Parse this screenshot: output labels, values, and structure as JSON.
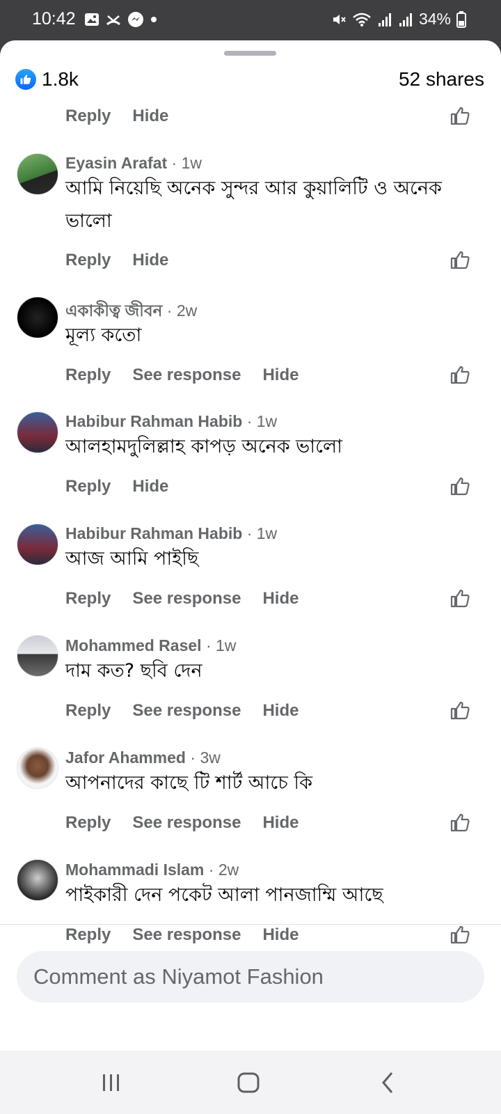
{
  "status_bar": {
    "time": "10:42",
    "battery": "34%",
    "left_icons": [
      "gallery-icon",
      "missed-call-icon",
      "messenger-icon",
      "dot-icon"
    ],
    "right_icons": [
      "mute-icon",
      "wifi-icon",
      "signal-icon",
      "signal-icon",
      "battery-icon"
    ]
  },
  "post_stats": {
    "reaction_count": "1.8k",
    "shares": "52 shares"
  },
  "top_actions": {
    "reply": "Reply",
    "hide": "Hide"
  },
  "comments": [
    {
      "name": "Eyasin Arafat",
      "time": "1w",
      "text": "আমি নিয়েছি অনেক সুন্দর আর কুয়ালিটি ও অনেক ভালো",
      "actions": [
        "Reply",
        "Hide"
      ]
    },
    {
      "name": "একাকীত্ব জীবন",
      "time": "2w",
      "text": "মূল্য কতো",
      "actions": [
        "Reply",
        "See response",
        "Hide"
      ]
    },
    {
      "name": "Habibur Rahman Habib",
      "time": "1w",
      "text": "আলহামদুলিল্লাহ কাপড় অনেক ভালো",
      "actions": [
        "Reply",
        "Hide"
      ]
    },
    {
      "name": "Habibur Rahman Habib",
      "time": "1w",
      "text": "আজ আমি পাইছি",
      "actions": [
        "Reply",
        "See response",
        "Hide"
      ]
    },
    {
      "name": "Mohammed Rasel",
      "time": "1w",
      "text": "দাম কত? ছবি দেন",
      "actions": [
        "Reply",
        "See response",
        "Hide"
      ]
    },
    {
      "name": "Jafor Ahammed",
      "time": "3w",
      "text": "আপনাদের কাছে টি শার্ট আচে কি",
      "actions": [
        "Reply",
        "See response",
        "Hide"
      ]
    },
    {
      "name": "Mohammadi Islam",
      "time": "2w",
      "text": "পাইকারী দেন পকেট আলা পানজাম্মি আছে",
      "actions": [
        "Reply",
        "See response",
        "Hide"
      ]
    }
  ],
  "composer": {
    "placeholder": "Comment as Niyamot Fashion"
  },
  "nav_bar": {
    "buttons": [
      "recent-apps-icon",
      "home-icon",
      "back-icon"
    ]
  },
  "colors": {
    "accent": "#0866ff",
    "secondary_text": "#65676b",
    "input_bg": "#f0f2f5"
  }
}
